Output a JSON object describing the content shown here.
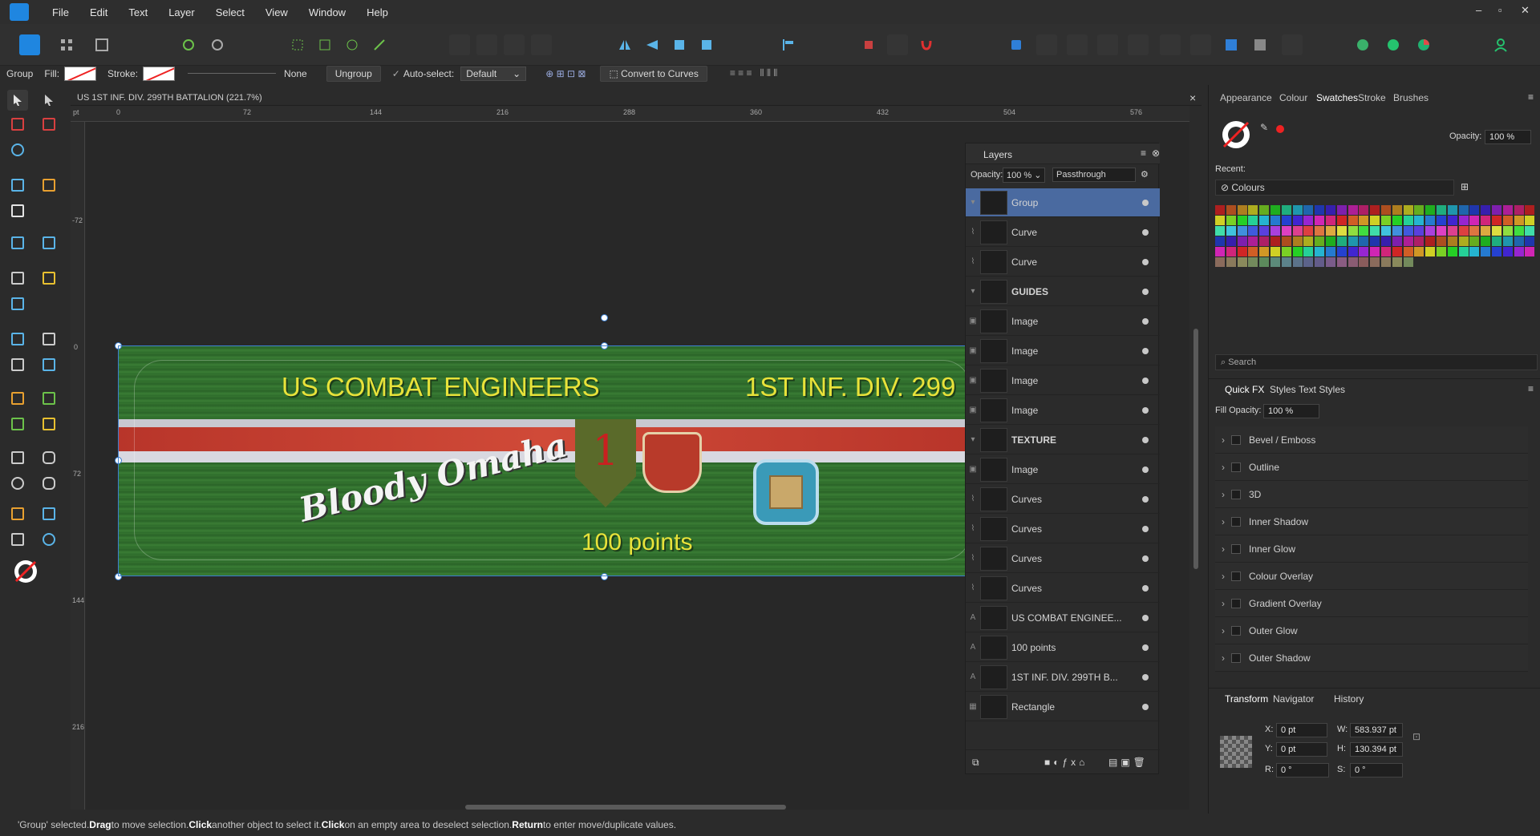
{
  "menu": {
    "items": [
      "File",
      "Edit",
      "Text",
      "Layer",
      "Select",
      "View",
      "Window",
      "Help"
    ],
    "window_controls": [
      "–",
      "▫",
      "✕"
    ]
  },
  "context": {
    "kind": "Group",
    "fill_label": "Fill:",
    "stroke_label": "Stroke:",
    "stroke_width": "None",
    "ungroup": "Ungroup",
    "autoselect_label": "Auto-select:",
    "autoselect_value": "Default",
    "convert": "Convert to Curves"
  },
  "document": {
    "tab_title": "US 1ST INF. DIV. 299TH BATTALION (221.7%)",
    "close": "×",
    "ruler_unit": "pt",
    "ruler_top": [
      "0",
      "72",
      "144",
      "216",
      "288",
      "360",
      "432",
      "504",
      "576"
    ],
    "ruler_left": [
      "-72",
      "0",
      "72",
      "144",
      "216"
    ]
  },
  "banner": {
    "headline_left": "US COMBAT ENGINEERS",
    "headline_right": "1ST INF. DIV. 299",
    "slogan": "Bloody Omaha",
    "points": "100 points",
    "badge_number": "1"
  },
  "layers_panel": {
    "title": "Layers",
    "opacity_label": "Opacity:",
    "opacity_value": "100 %",
    "blend_value": "Passthrough",
    "rows": [
      {
        "name": "Group",
        "kind": "group",
        "bold": false
      },
      {
        "name": "Curve",
        "kind": "curve",
        "bold": false
      },
      {
        "name": "Curve",
        "kind": "curve",
        "bold": false
      },
      {
        "name": "GUIDES",
        "kind": "group",
        "bold": true
      },
      {
        "name": "Image",
        "kind": "image",
        "bold": false
      },
      {
        "name": "Image",
        "kind": "image",
        "bold": false
      },
      {
        "name": "Image",
        "kind": "image",
        "bold": false
      },
      {
        "name": "Image",
        "kind": "image",
        "bold": false
      },
      {
        "name": "TEXTURE",
        "kind": "group",
        "bold": true
      },
      {
        "name": "Image",
        "kind": "image",
        "bold": false
      },
      {
        "name": "Curves",
        "kind": "curve",
        "bold": false
      },
      {
        "name": "Curves",
        "kind": "curve",
        "bold": false
      },
      {
        "name": "Curves",
        "kind": "curve",
        "bold": false
      },
      {
        "name": "Curves",
        "kind": "curve",
        "bold": false
      },
      {
        "name": "US COMBAT ENGINEE...",
        "kind": "text",
        "bold": false
      },
      {
        "name": "100 points",
        "kind": "text",
        "bold": false
      },
      {
        "name": "1ST INF. DIV. 299TH B...",
        "kind": "text",
        "bold": false
      },
      {
        "name": "Rectangle",
        "kind": "shape",
        "bold": false
      }
    ]
  },
  "swatches_panel": {
    "tabs": [
      "Appearance",
      "Colour",
      "Swatches",
      "Stroke",
      "Brushes"
    ],
    "active_tab": "Swatches",
    "opacity_label": "Opacity:",
    "opacity_value": "100 %",
    "recent_label": "Recent:",
    "palette_name": "Colours",
    "search_placeholder": "Search"
  },
  "fx_panel": {
    "tabs": [
      "Quick FX",
      "Styles",
      "Text Styles"
    ],
    "fill_opacity_label": "Fill Opacity:",
    "fill_opacity_value": "100 %",
    "effects": [
      "Bevel / Emboss",
      "Outline",
      "3D",
      "Inner Shadow",
      "Inner Glow",
      "Colour Overlay",
      "Gradient Overlay",
      "Outer Glow",
      "Outer Shadow"
    ]
  },
  "transform_panel": {
    "tabs": [
      "Transform",
      "Navigator",
      "History"
    ],
    "x_label": "X:",
    "x": "0 pt",
    "y_label": "Y:",
    "y": "0 pt",
    "w_label": "W:",
    "w": "583.937 pt",
    "h_label": "H:",
    "h": "130.394 pt",
    "r_label": "R:",
    "r": "0 °",
    "s_label": "S:",
    "s": "0 °"
  },
  "status": {
    "p1": "'Group' selected. ",
    "k1": "Drag",
    "p2": " to move selection. ",
    "k2": "Click",
    "p3": " another object to select it. ",
    "k3": "Click",
    "p4": " on an empty area to deselect selection. ",
    "k4": "Return",
    "p5": " to enter move/duplicate values."
  },
  "colors": {
    "accent": "#4a6aa0",
    "banner_green": "#357530",
    "banner_red": "#c0392b",
    "headline_yellow": "#e8e23a"
  }
}
